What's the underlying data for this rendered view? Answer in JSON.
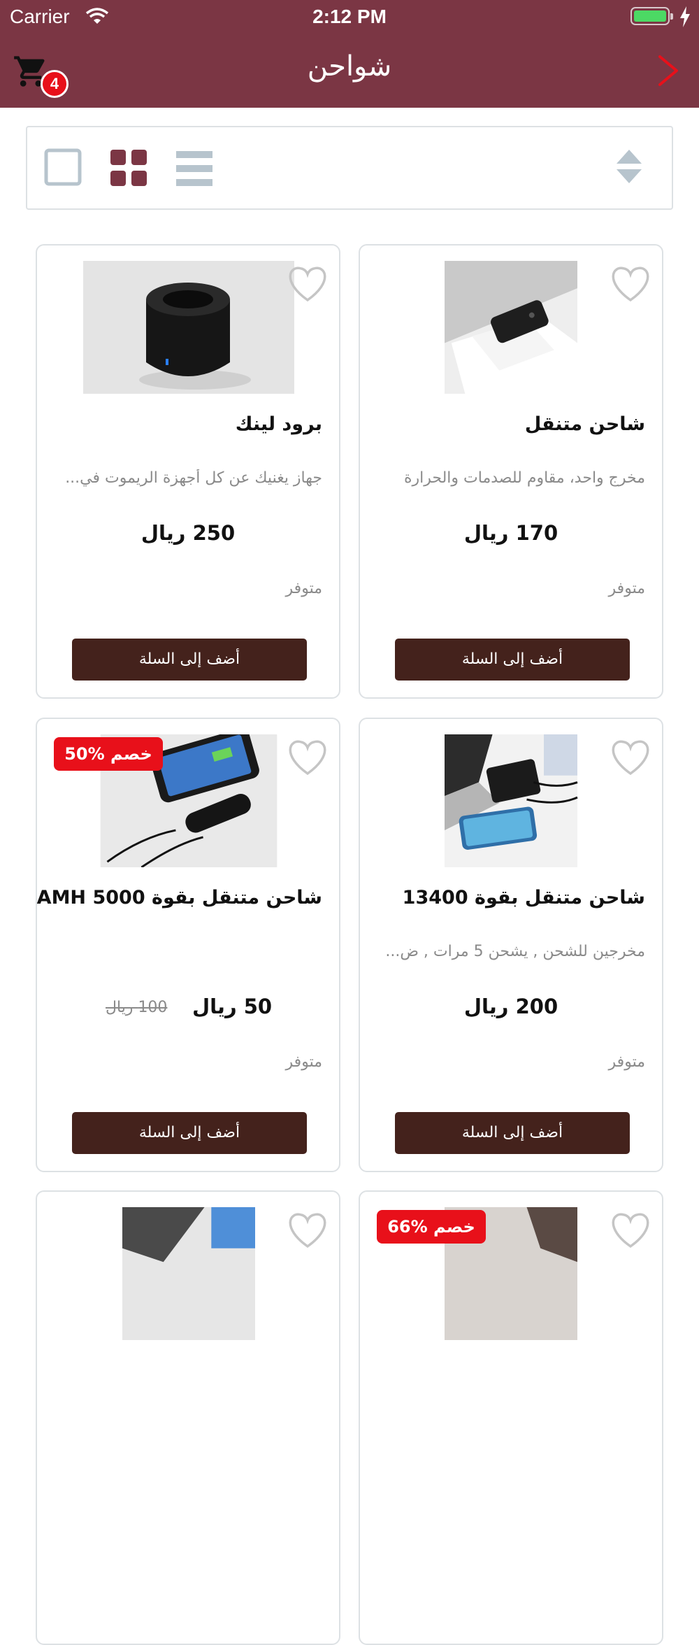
{
  "status_bar": {
    "carrier": "Carrier",
    "time": "2:12 PM"
  },
  "nav": {
    "title": "شواحن",
    "cart_count": "4"
  },
  "colors": {
    "nav_bg": "#7b3644",
    "accent": "#7b3644",
    "button_bg": "#44221c",
    "discount_bg": "#e8101a",
    "back_arrow": "#e8101a"
  },
  "products": [
    {
      "name": "شاحن متنقل",
      "desc": "مخرج واحد، مقاوم للصدمات والحرارة",
      "price": "170 ريال",
      "stock": "متوفر",
      "button": "أضف إلى السلة"
    },
    {
      "name": "برود لينك",
      "desc": "جهاز يغنيك عن كل أجهزة الريموت في...",
      "price": "250 ريال",
      "stock": "متوفر",
      "button": "أضف إلى السلة"
    },
    {
      "name": "شاحن متنقل بقوة 13400",
      "desc": "مخرجين للشحن , يشحن 5 مرات , ض...",
      "price": "200 ريال",
      "stock": "متوفر",
      "button": "أضف إلى السلة"
    },
    {
      "name": "شاحن متنقل بقوة 5000 AMH",
      "desc": "",
      "price": "50 ريال",
      "old_price": "100 ريال",
      "discount": "50% خصم",
      "stock": "متوفر",
      "button": "أضف إلى السلة"
    },
    {
      "discount": "66% خصم"
    }
  ]
}
